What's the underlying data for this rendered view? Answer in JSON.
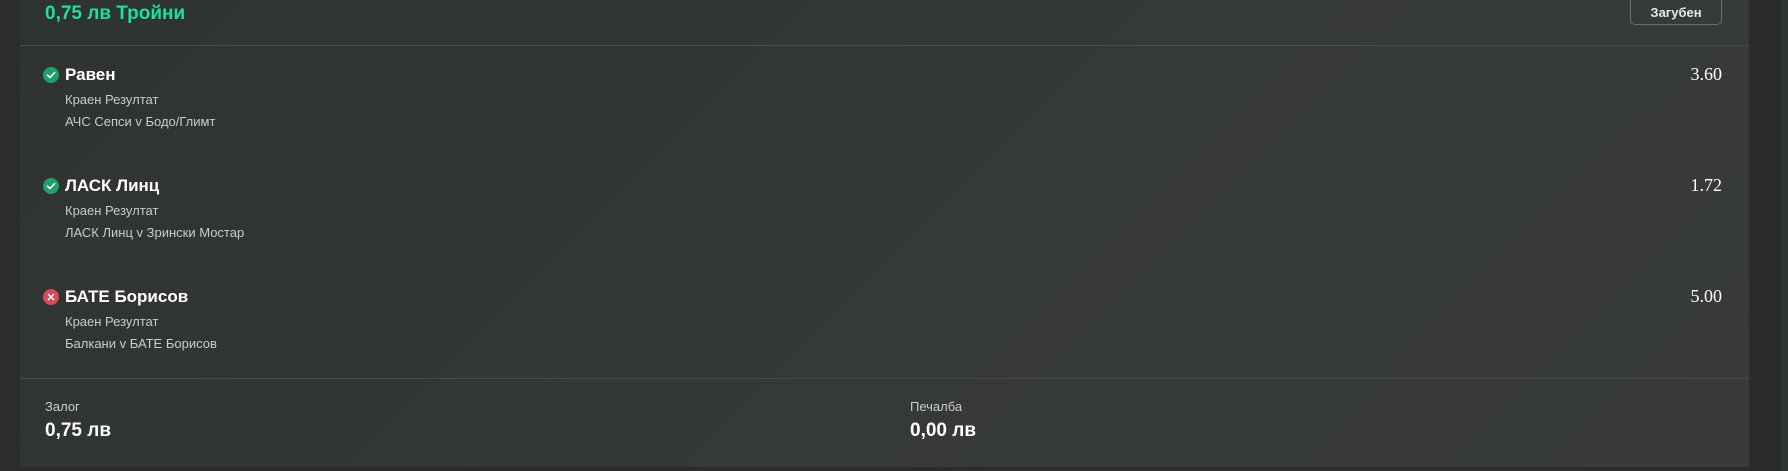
{
  "bet": {
    "title": "0,75 лв Тройни",
    "status_label": "Загубен"
  },
  "selections": [
    {
      "status": "won",
      "status_icon": "check-icon",
      "name": "Равен",
      "market": "Краен Резултат",
      "event": "АЧС Сепси v Бодо/Глимт",
      "odds": "3.60"
    },
    {
      "status": "won",
      "status_icon": "check-icon",
      "name": "ЛАСК Линц",
      "market": "Краен Резултат",
      "event": "ЛАСК Линц v Зрински Мостар",
      "odds": "1.72"
    },
    {
      "status": "lost",
      "status_icon": "cross-icon",
      "name": "БАТЕ Борисов",
      "market": "Краен Резултат",
      "event": "Балкани v БАТЕ Борисов",
      "odds": "5.00"
    }
  ],
  "summary": {
    "stake_label": "Залог",
    "stake_value": "0,75 лв",
    "payout_label": "Печалба",
    "payout_value": "0,00 лв"
  },
  "colors": {
    "title_accent": "#19e39a",
    "won": "#1fa06a",
    "lost": "#d64a56"
  }
}
